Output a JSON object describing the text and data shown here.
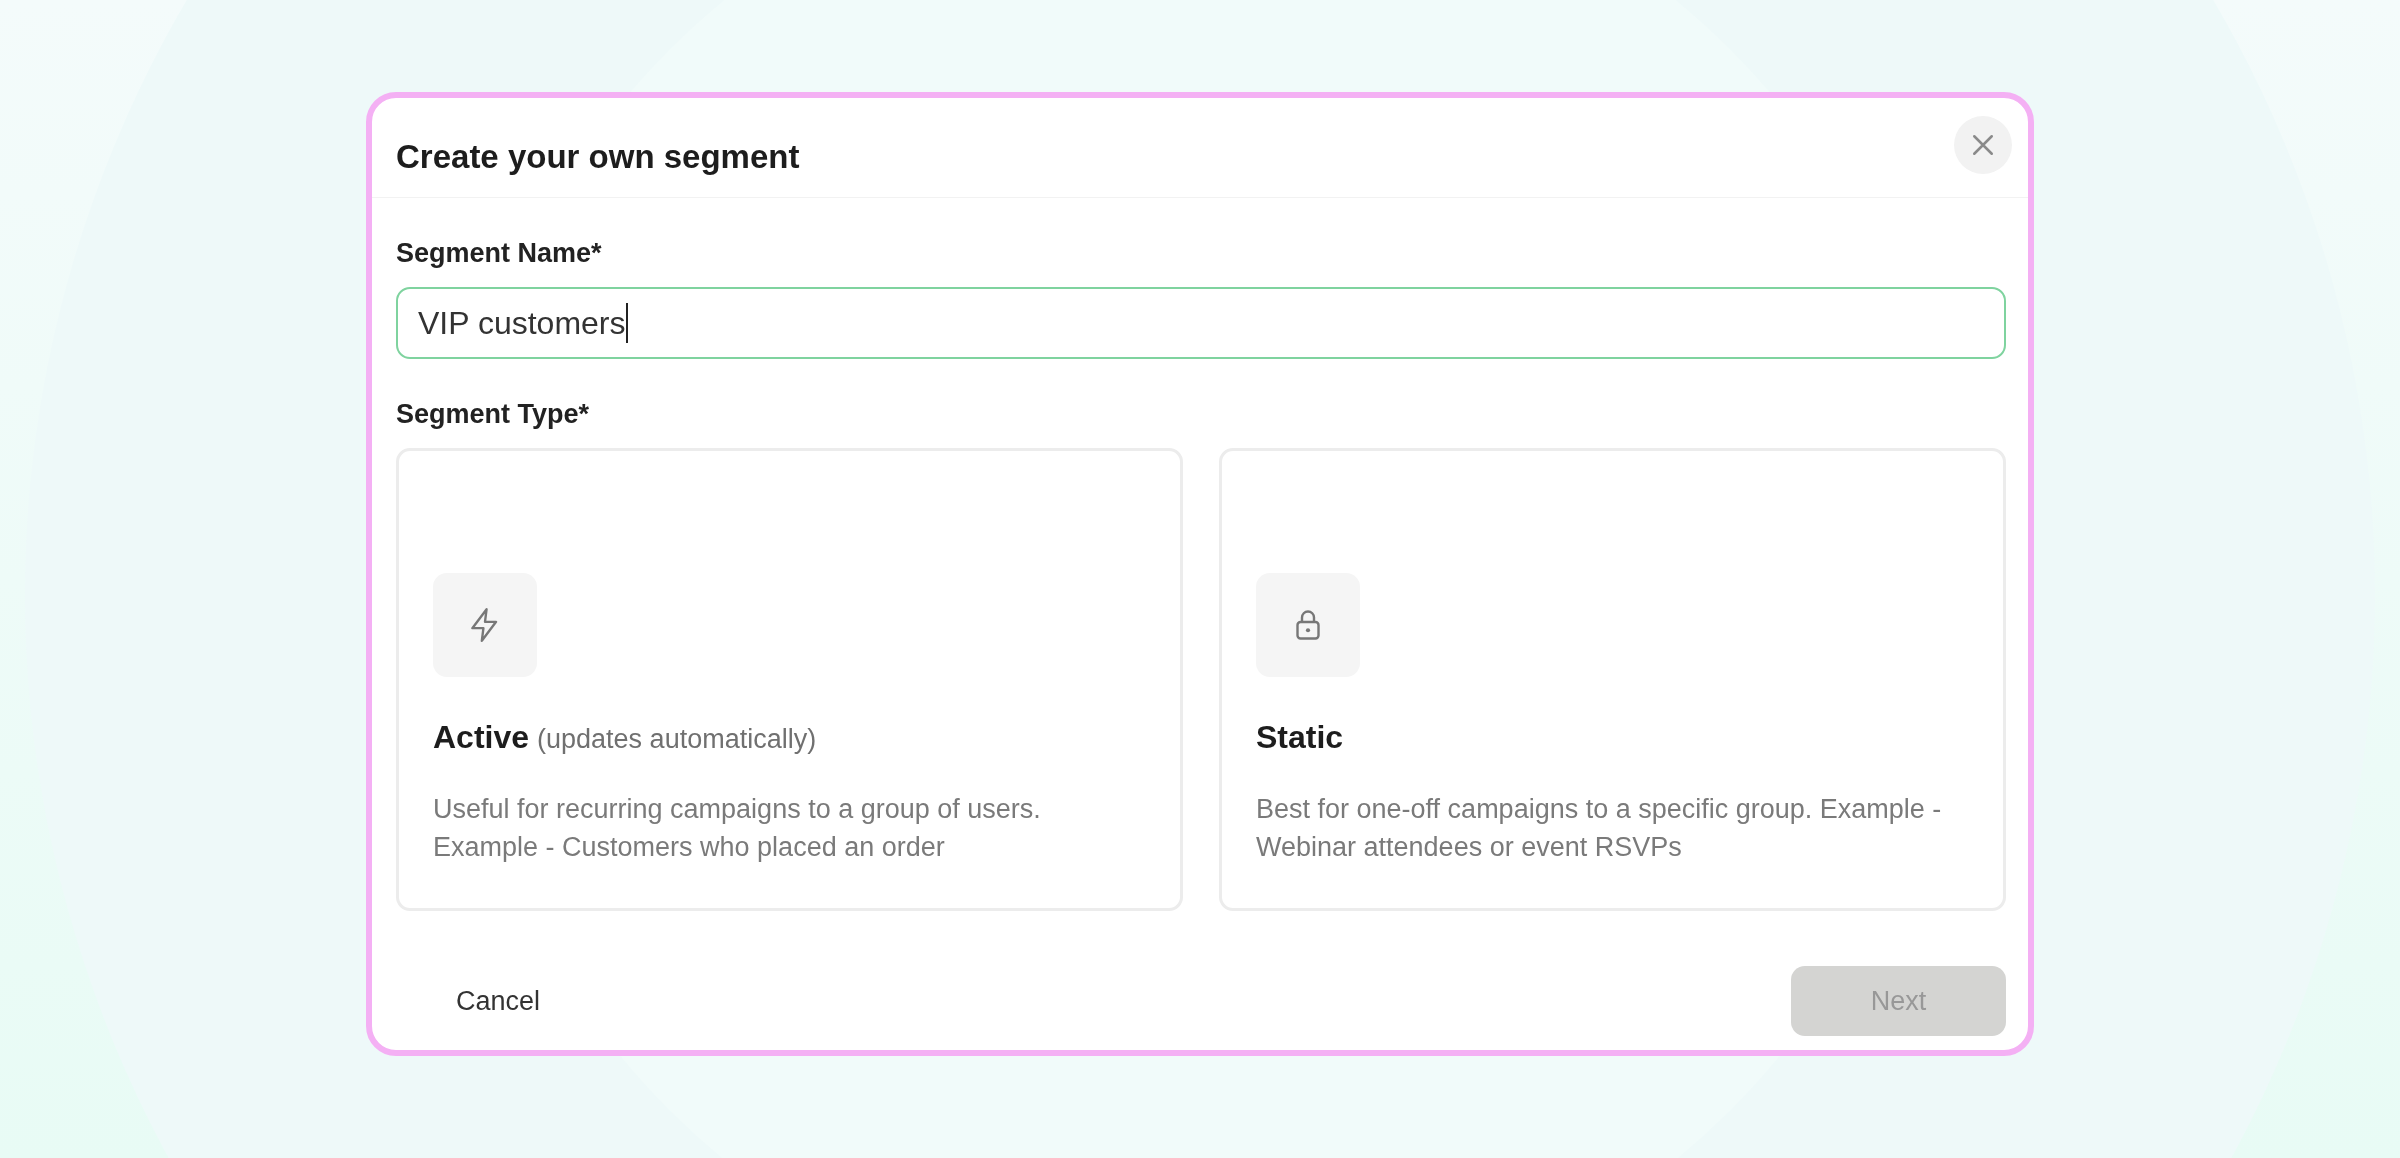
{
  "dialog": {
    "title": "Create your own segment"
  },
  "name_field": {
    "label": "Segment Name*",
    "value": "VIP customers",
    "focused": true
  },
  "type_field": {
    "label": "Segment Type*"
  },
  "options": [
    {
      "kind": "lightning",
      "title": "Active",
      "note": "(updates automatically)",
      "description": "Useful for recurring campaigns to a group of users. Example - Customers who placed an order",
      "selected": false
    },
    {
      "kind": "lock",
      "title": "Static",
      "description": "Best for one-off campaigns to a specific group. Example - Webinar attendees or event RSVPs",
      "selected": false
    }
  ],
  "buttons": {
    "cancel": "Cancel",
    "next": {
      "label": "Next",
      "disabled": true
    }
  }
}
